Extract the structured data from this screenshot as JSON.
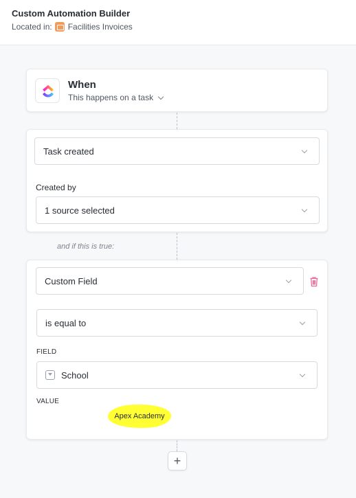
{
  "header": {
    "title": "Custom Automation Builder",
    "located_prefix": "Located in:",
    "location_name": "Facilities Invoices",
    "location_icon": "list-icon"
  },
  "when_card": {
    "logo": "clickup-logo",
    "title": "When",
    "subtitle": "This happens on a task"
  },
  "trigger_card": {
    "trigger_select": "Task created",
    "created_by_label": "Created by",
    "created_by_select": "1 source selected"
  },
  "condition_text": "and if this is true:",
  "condition_card": {
    "type_select": "Custom Field",
    "operator_select": "is equal to",
    "field_label": "FIELD",
    "field_select": "School",
    "value_label": "VALUE",
    "value": "Apex Academy",
    "delete_icon": "trash-icon"
  },
  "add_button_label": "+",
  "colors": {
    "highlight": "#ffff33",
    "trash": "#e86a9a",
    "list_icon": "#f19b5d"
  }
}
